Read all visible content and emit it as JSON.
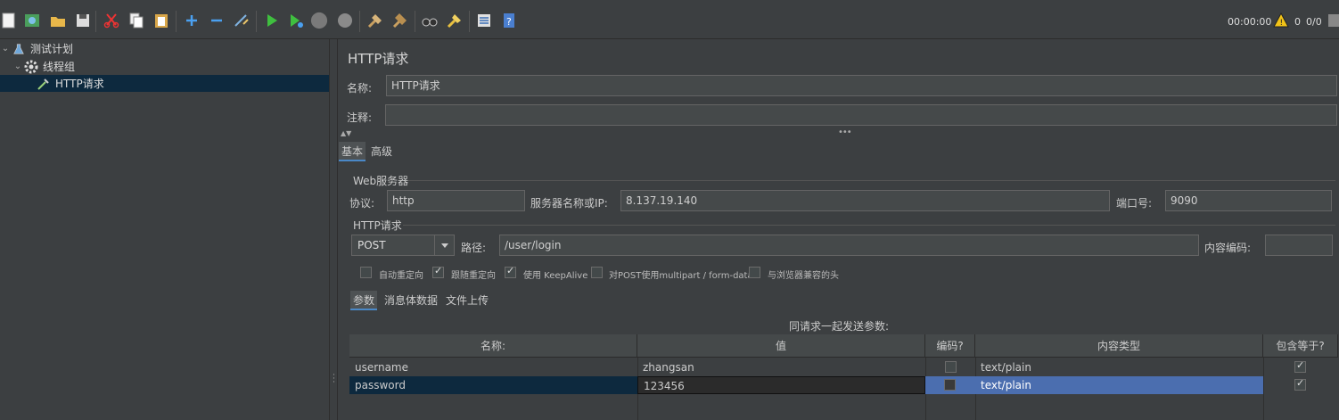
{
  "toolbar": {
    "timer": "00:00:00",
    "warning_count": "0",
    "thread_count": "0/0"
  },
  "tree": {
    "items": [
      {
        "label": "测试计划"
      },
      {
        "label": "线程组"
      },
      {
        "label": "HTTP请求"
      }
    ]
  },
  "panel": {
    "title": "HTTP请求",
    "name_label": "名称:",
    "name_value": "HTTP请求",
    "comment_label": "注释:",
    "comment_value": "",
    "tabs": [
      {
        "label": "基本"
      },
      {
        "label": "高级"
      }
    ],
    "web_server": {
      "group_title": "Web服务器",
      "protocol_label": "协议:",
      "protocol_value": "http",
      "server_label": "服务器名称或IP:",
      "server_value": "8.137.19.140",
      "port_label": "端口号:",
      "port_value": "9090"
    },
    "http_request": {
      "group_title": "HTTP请求",
      "method_value": "POST",
      "path_label": "路径:",
      "path_value": "/user/login",
      "encoding_label": "内容编码:",
      "encoding_value": ""
    },
    "options": [
      {
        "label": "自动重定向",
        "checked": false
      },
      {
        "label": "跟随重定向",
        "checked": true
      },
      {
        "label": "使用 KeepAlive",
        "checked": true
      },
      {
        "label": "对POST使用multipart / form-data",
        "checked": false
      },
      {
        "label": "与浏览器兼容的头",
        "checked": false
      }
    ],
    "subtabs": [
      {
        "label": "参数"
      },
      {
        "label": "消息体数据"
      },
      {
        "label": "文件上传"
      }
    ],
    "params_title": "同请求一起发送参数:",
    "table": {
      "headers": [
        "名称:",
        "值",
        "编码?",
        "内容类型",
        "包含等于?"
      ],
      "rows": [
        {
          "name": "username",
          "value": "zhangsan",
          "encode": false,
          "content_type": "text/plain",
          "include_equals": true
        },
        {
          "name": "password",
          "value": "123456",
          "encode": false,
          "content_type": "text/plain",
          "include_equals": true
        }
      ]
    }
  },
  "colors": {
    "background": "#3c3f41",
    "selection": "#0d293e",
    "row_selected_blue": "#4b6eaf"
  }
}
